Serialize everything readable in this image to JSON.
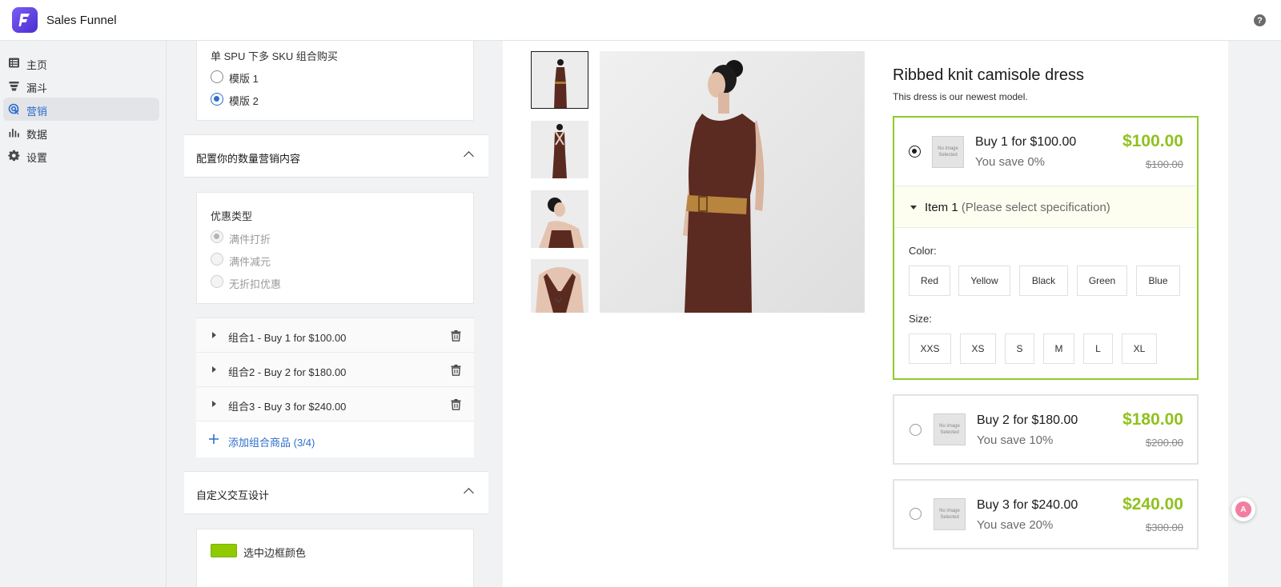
{
  "app": {
    "title": "Sales Funnel"
  },
  "sidebar": {
    "items": [
      {
        "label": "主页",
        "icon": "list-icon"
      },
      {
        "label": "漏斗",
        "icon": "funnel-icon"
      },
      {
        "label": "营销",
        "icon": "target-icon",
        "active": true
      },
      {
        "label": "数据",
        "icon": "bar-chart-icon"
      },
      {
        "label": "设置",
        "icon": "gear-icon"
      }
    ]
  },
  "settings": {
    "template_section": {
      "label": "单 SPU 下多 SKU 组合购买",
      "options": [
        "模版 1",
        "模版 2"
      ],
      "selected": "模版 2"
    },
    "quantity_section": {
      "title": "配置你的数量营销内容",
      "discount_type_label": "优惠类型",
      "discount_options": [
        "满件打折",
        "满件减元",
        "无折扣优惠"
      ],
      "selected": "满件打折"
    },
    "combos": [
      {
        "label": "组合1 - Buy 1 for $100.00"
      },
      {
        "label": "组合2 - Buy 2 for $180.00"
      },
      {
        "label": "组合3 - Buy 3 for $240.00"
      }
    ],
    "add_combo_label": "添加组合商品 (3/4)",
    "design_section": {
      "title": "自定义交互设计",
      "border_color_label": "选中边框颜色",
      "border_color": "#8fcb00"
    }
  },
  "preview": {
    "product_title": "Ribbed knit camisole dress",
    "product_subtitle": "This dress is our newest model.",
    "no_image_text": "No image Selected",
    "bundles": [
      {
        "title": "Buy 1 for $100.00",
        "save": "You save 0%",
        "price": "$100.00",
        "original": "$100.00",
        "selected": true
      },
      {
        "title": "Buy 2 for $180.00",
        "save": "You save 10%",
        "price": "$180.00",
        "original": "$200.00"
      },
      {
        "title": "Buy 3 for $240.00",
        "save": "You save 20%",
        "price": "$240.00",
        "original": "$300.00"
      }
    ],
    "item": {
      "label": "Item 1",
      "hint": "(Please select specification)"
    },
    "color_label": "Color:",
    "colors": [
      "Red",
      "Yellow",
      "Black",
      "Green",
      "Blue"
    ],
    "size_label": "Size:",
    "sizes": [
      "XXS",
      "XS",
      "S",
      "M",
      "L",
      "XL"
    ]
  },
  "accent_color": "#8fc11e",
  "link_color": "#2c6ecb"
}
